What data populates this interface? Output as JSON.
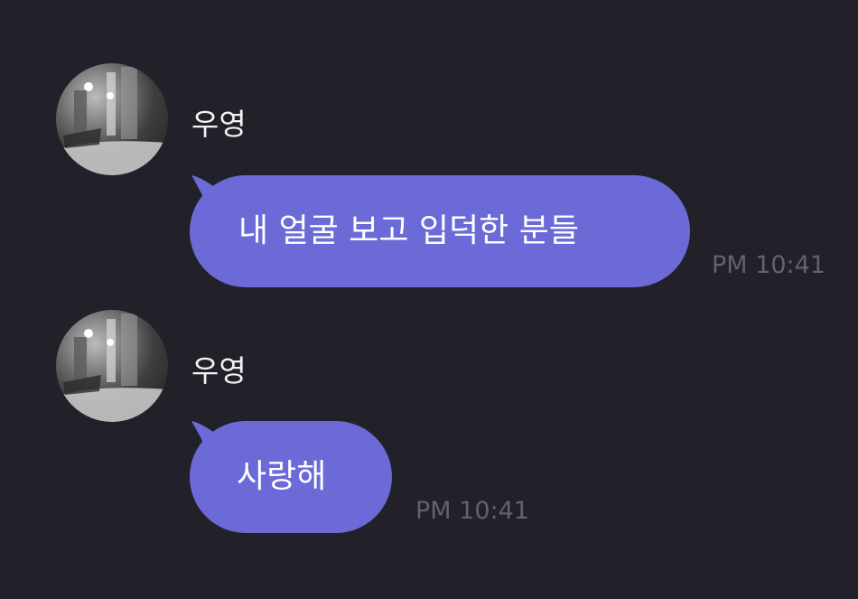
{
  "messages": [
    {
      "sender": "우영",
      "text": "내 얼굴 보고 입덕한 분들",
      "time": "PM 10:41"
    },
    {
      "sender": "우영",
      "text": "사랑해",
      "time": "PM 10:41"
    }
  ],
  "colors": {
    "background": "#222028",
    "bubble": "#6b6ad6",
    "name_text": "#f2f2f4",
    "time_text": "#63626a"
  },
  "icons": {
    "avatar": "profile-photo-night-street"
  }
}
